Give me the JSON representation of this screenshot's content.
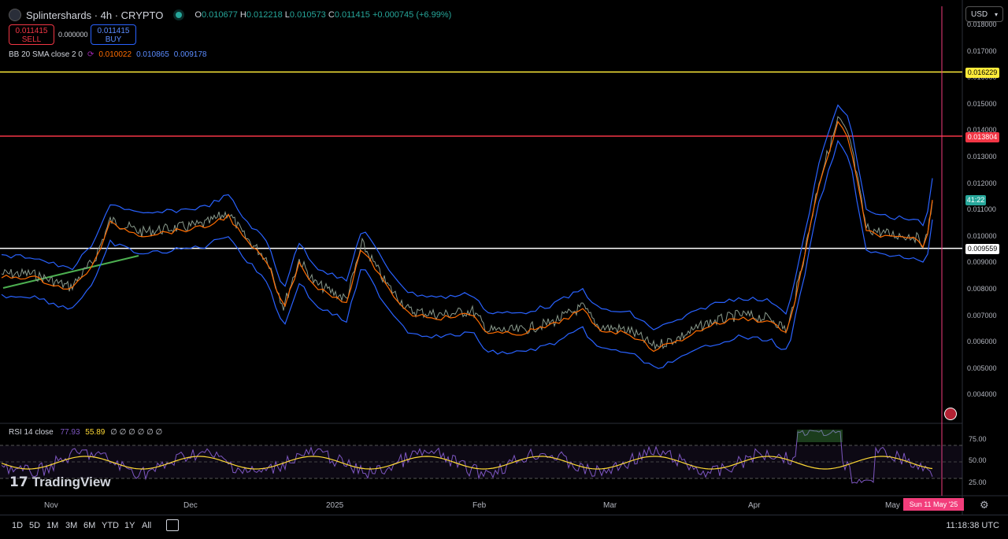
{
  "header": {
    "symbol_title": "Splintershards · 4h · CRYPTO",
    "ohlc": [
      {
        "k": "O",
        "v": "0.010677"
      },
      {
        "k": "H",
        "v": "0.012218"
      },
      {
        "k": "L",
        "v": "0.010573"
      },
      {
        "k": "C",
        "v": "0.011415"
      }
    ],
    "change": "+0.000745 (+6.99%)"
  },
  "trade": {
    "sell_price": "0.011415",
    "sell_label": "SELL",
    "spread": "0.000000",
    "buy_price": "0.011415",
    "buy_label": "BUY"
  },
  "bb_legend": {
    "label": "BB 20 SMA close 2 0",
    "basis": "0.010022",
    "upper": "0.010865",
    "lower": "0.009178"
  },
  "currency": "USD",
  "price_axis": [
    "0.018000",
    "0.017000",
    "0.016000",
    "0.015000",
    "0.014000",
    "0.013000",
    "0.012000",
    "0.011000",
    "0.010000",
    "0.009000",
    "0.008000",
    "0.007000",
    "0.006000",
    "0.005000",
    "0.004000"
  ],
  "price_tags": {
    "yellow_line": "0.016229",
    "red_line": "0.013804",
    "current": "41:22",
    "white_line": "0.009559"
  },
  "rsi": {
    "label": "RSI 14 close",
    "value": "77.93",
    "ma": "55.89",
    "extra": "∅ ∅ ∅ ∅ ∅ ∅",
    "axis": [
      "75.00",
      "50.00",
      "25.00"
    ]
  },
  "time_axis": [
    "Nov",
    "Dec",
    "2025",
    "Feb",
    "Mar",
    "Apr",
    "May"
  ],
  "cursor_date": "Sun 11 May '25",
  "watermark": "TradingView",
  "ranges": [
    "1D",
    "5D",
    "1M",
    "3M",
    "6M",
    "YTD",
    "1Y",
    "All"
  ],
  "clock": "11:18:38 UTC",
  "colors": {
    "bb_upper": "#2962ff",
    "bb_basis": "#ff6d00",
    "trend": "#4caf50",
    "yellow_line": "#ffeb3b",
    "red_line": "#f23645",
    "cursor": "#f23d7b",
    "rsi": "#7e57c2",
    "rsi_ma": "#fdd835"
  },
  "chart_data": {
    "type": "line",
    "ylim": [
      0.0035,
      0.0185
    ],
    "x": [
      "Nov",
      "Dec",
      "2025",
      "Feb",
      "Mar",
      "Apr",
      "May"
    ],
    "series": [
      {
        "name": "BB 20 SMA close 2 0",
        "values": [
          0.0085,
          0.0102,
          0.0087,
          0.0068,
          0.0065,
          0.0069,
          0.01
        ]
      }
    ],
    "horizontal_lines": [
      0.016229,
      0.013804,
      0.009559
    ]
  }
}
